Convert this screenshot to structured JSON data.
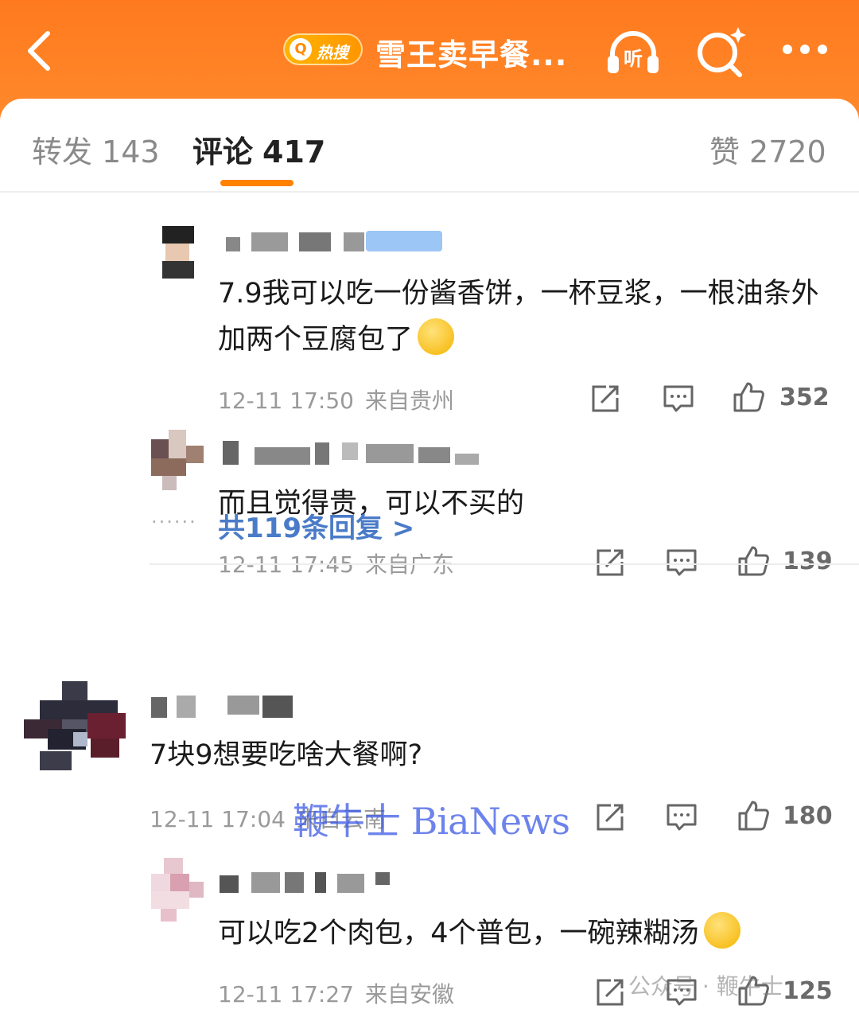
{
  "header": {
    "hot_label": "热搜",
    "title": "雪王卖早餐...",
    "listen_label": "听"
  },
  "tabs": {
    "repost_label": "转发",
    "repost_count": "143",
    "comment_label": "评论",
    "comment_count": "417",
    "like_label": "赞",
    "like_count": "2720"
  },
  "comments": [
    {
      "text": "7.9我可以吃一份酱香饼，一杯豆浆，一根油条外加两个豆腐包了",
      "emoji": "sweat-smile-emoji",
      "time": "12-11 17:50",
      "location": "来自贵州",
      "likes": "352"
    },
    {
      "text": "而且觉得贵，可以不买的",
      "time": "12-11 17:45",
      "location": "来自广东",
      "likes": "139"
    },
    {
      "text": "7块9想要吃啥大餐啊?",
      "time": "12-11 17:04",
      "location": "来自云南",
      "likes": "180"
    },
    {
      "text": "可以吃2个肉包，4个普包，一碗辣糊汤",
      "emoji": "laughing-emoji",
      "time": "12-11 17:27",
      "location": "来自安徽",
      "likes": "125"
    }
  ],
  "replies": {
    "dots": "······",
    "link": "共119条回复 >"
  },
  "watermark": {
    "main": "鞭牛士 BiaNews",
    "secondary": "公众号 · 鞭牛士"
  }
}
